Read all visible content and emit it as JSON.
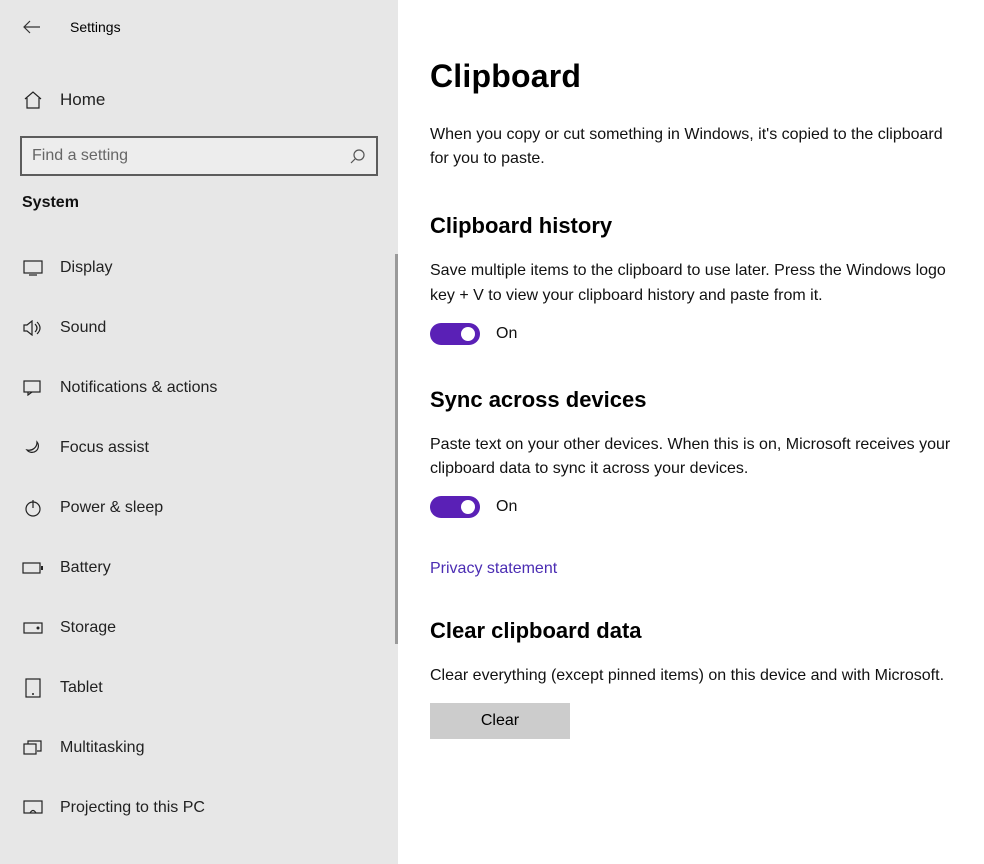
{
  "header": {
    "title": "Settings",
    "home_label": "Home"
  },
  "search": {
    "placeholder": "Find a setting"
  },
  "category": "System",
  "nav": [
    {
      "label": "Display"
    },
    {
      "label": "Sound"
    },
    {
      "label": "Notifications & actions"
    },
    {
      "label": "Focus assist"
    },
    {
      "label": "Power & sleep"
    },
    {
      "label": "Battery"
    },
    {
      "label": "Storage"
    },
    {
      "label": "Tablet"
    },
    {
      "label": "Multitasking"
    },
    {
      "label": "Projecting to this PC"
    }
  ],
  "main": {
    "title": "Clipboard",
    "intro": "When you copy or cut something in Windows, it's copied to the clipboard for you to paste.",
    "history": {
      "title": "Clipboard history",
      "desc": "Save multiple items to the clipboard to use later. Press the Windows logo key + V to view your clipboard history and paste from it.",
      "state": "On"
    },
    "sync": {
      "title": "Sync across devices",
      "desc": "Paste text on your other devices. When this is on, Microsoft receives your clipboard data to sync it across your devices.",
      "state": "On",
      "privacy_link": "Privacy statement"
    },
    "clear": {
      "title": "Clear clipboard data",
      "desc": "Clear everything (except pinned items) on this device and with Microsoft.",
      "button": "Clear"
    }
  }
}
